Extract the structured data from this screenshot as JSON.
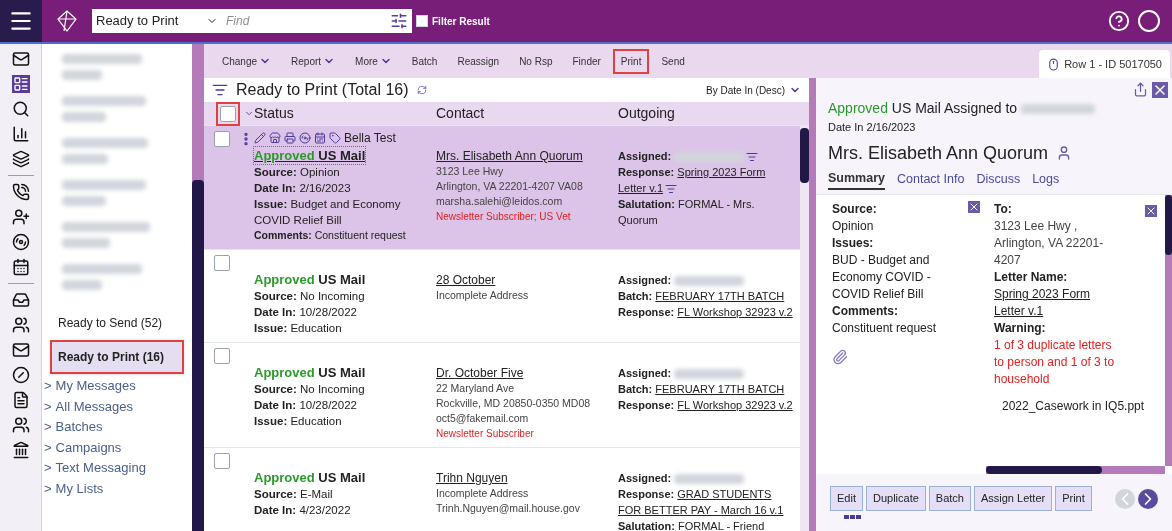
{
  "topbar": {
    "view_select": "Ready to Print",
    "find_placeholder": "Find",
    "filter_result": {
      "label": "Filter Result",
      "checked": false
    }
  },
  "sidebar": {
    "items": [
      {
        "label": "Ready to Send (52)",
        "selected": false,
        "highlighted": false
      },
      {
        "label": "Ready to Print (16)",
        "selected": true,
        "highlighted": true
      }
    ],
    "groups": [
      {
        "expander": ">",
        "label": "My Messages"
      },
      {
        "expander": ">",
        "label": "All Messages"
      },
      {
        "expander": ">",
        "label": "Batches"
      },
      {
        "expander": ">",
        "label": "Campaigns"
      },
      {
        "expander": ">",
        "label": "Text Messaging"
      },
      {
        "expander": ">",
        "label": "My Lists"
      }
    ]
  },
  "toolbar": [
    {
      "label": "Change",
      "dropdown": true,
      "highlighted": false
    },
    {
      "label": "Report",
      "dropdown": true,
      "highlighted": false
    },
    {
      "label": "More",
      "dropdown": true,
      "highlighted": false
    },
    {
      "label": "Batch",
      "dropdown": false,
      "highlighted": false
    },
    {
      "label": "Reassign",
      "dropdown": false,
      "highlighted": false
    },
    {
      "label": "No Rsp",
      "dropdown": false,
      "highlighted": false
    },
    {
      "label": "Finder",
      "dropdown": false,
      "highlighted": false
    },
    {
      "label": "Print",
      "dropdown": false,
      "highlighted": true
    },
    {
      "label": "Send",
      "dropdown": false,
      "highlighted": false
    }
  ],
  "list": {
    "title": "Ready to Print (Total 16)",
    "sort": "By Date In (Desc)",
    "select_all": {
      "checked": false,
      "highlighted": true
    },
    "columns": [
      "Status",
      "Contact",
      "Outgoing"
    ],
    "rows": [
      {
        "selected": true,
        "checked": false,
        "owner": "Bella Test",
        "status": "Approved",
        "mail_type": "US Mail",
        "fields": [
          {
            "label": "Source:",
            "value": "Opinion"
          },
          {
            "label": "Date In:",
            "value": "2/16/2023"
          },
          {
            "label": "Issue:",
            "value": "Budget and Economy COVID Relief Bill"
          }
        ],
        "comments": {
          "label": "Comments:",
          "value": "Constituent request"
        },
        "contact": {
          "name": "Mrs. Elisabeth Ann Quorum",
          "lines": [
            "3123 Lee Hwy",
            "Arlington, VA 22201-4207  VA08",
            "marsha.salehi@leidos.com"
          ],
          "tags": "Newsletter Subscriber; US Vet"
        },
        "outgoing": [
          {
            "label": "Assigned:",
            "kind": "redacted",
            "filter": true
          },
          {
            "label": "Response:",
            "kind": "link",
            "value": "Spring 2023 Form Letter v.1",
            "filter": true
          },
          {
            "label": "Salutation:",
            "kind": "text",
            "value": "FORMAL - Mrs. Quorum",
            "filter": false
          }
        ]
      },
      {
        "selected": false,
        "checked": false,
        "status": "Approved",
        "mail_type": "US Mail",
        "fields": [
          {
            "label": "Source:",
            "value": "No Incoming"
          },
          {
            "label": "Date In:",
            "value": "10/28/2022"
          },
          {
            "label": "Issue:",
            "value": "Education"
          }
        ],
        "contact": {
          "name": "28 October",
          "lines": [
            "Incomplete Address"
          ]
        },
        "outgoing": [
          {
            "label": "Assigned:",
            "kind": "redacted",
            "filter": false
          },
          {
            "label": "Batch:",
            "kind": "link",
            "value": "FEBRUARY 17TH BATCH",
            "filter": false
          },
          {
            "label": "Response:",
            "kind": "link",
            "value": "FL Workshop 32923 v.2",
            "filter": false
          }
        ]
      },
      {
        "selected": false,
        "checked": false,
        "status": "Approved",
        "mail_type": "US Mail",
        "fields": [
          {
            "label": "Source:",
            "value": "No Incoming"
          },
          {
            "label": "Date In:",
            "value": "10/28/2022"
          },
          {
            "label": "Issue:",
            "value": "Education"
          }
        ],
        "contact": {
          "name": "Dr. October Five",
          "lines": [
            "22 Maryland Ave",
            "Rockville, MD 20850-0350  MD08",
            "oct5@fakemail.com"
          ],
          "tags": "Newsletter Subscriber"
        },
        "outgoing": [
          {
            "label": "Assigned:",
            "kind": "redacted",
            "filter": false
          },
          {
            "label": "Batch:",
            "kind": "link",
            "value": "FEBRUARY 17TH BATCH",
            "filter": false
          },
          {
            "label": "Response:",
            "kind": "link",
            "value": "FL Workshop 32923 v.2",
            "filter": false
          }
        ]
      },
      {
        "selected": false,
        "checked": false,
        "status": "Approved",
        "mail_type": "US Mail",
        "fields": [
          {
            "label": "Source:",
            "value": "E-Mail"
          },
          {
            "label": "Date In:",
            "value": "4/23/2022"
          }
        ],
        "contact": {
          "name": "Trihn Nguyen",
          "lines": [
            "Incomplete Address",
            "Trinh.Nguyen@mail.house.gov"
          ]
        },
        "outgoing": [
          {
            "label": "Assigned:",
            "kind": "redacted",
            "filter": false
          },
          {
            "label": "Response:",
            "kind": "link",
            "value": "GRAD STUDENTS FOR BETTER PAY - March 16 v.1",
            "filter": false
          },
          {
            "label": "Salutation:",
            "kind": "text",
            "value": "FORMAL - Friend",
            "filter": false
          }
        ]
      }
    ]
  },
  "detail": {
    "row_tab": "Row 1 - ID 5017050",
    "status": "Approved",
    "heading": "US Mail Assigned to",
    "date": "Date In 2/16/2023",
    "name": "Mrs. Elisabeth Ann Quorum",
    "tabs": [
      {
        "label": "Summary",
        "selected": true
      },
      {
        "label": "Contact Info",
        "selected": false
      },
      {
        "label": "Discuss",
        "selected": false
      },
      {
        "label": "Logs",
        "selected": false
      }
    ],
    "left": [
      {
        "label": "Source:",
        "value": "Opinion"
      },
      {
        "label": "Issues:",
        "value": "BUD - Budget and Economy COVID - COVID Relief Bill"
      },
      {
        "label": "Comments:",
        "value": "Constituent request"
      }
    ],
    "right": [
      {
        "label": "To:",
        "kind": "text",
        "value": "3123 Lee Hwy , Arlington, VA 22201-4207"
      },
      {
        "label": "Letter Name:",
        "kind": "link",
        "value": "Spring 2023 Form Letter v.1"
      },
      {
        "label": "Warning:",
        "kind": "warning",
        "value": "1 of 3 duplicate letters to person and 1 of 3 to household"
      }
    ],
    "attachment": "2022_Casework in IQ5.ppt",
    "buttons": [
      "Edit",
      "Duplicate",
      "Batch",
      "Assign Letter",
      "Print"
    ]
  }
}
